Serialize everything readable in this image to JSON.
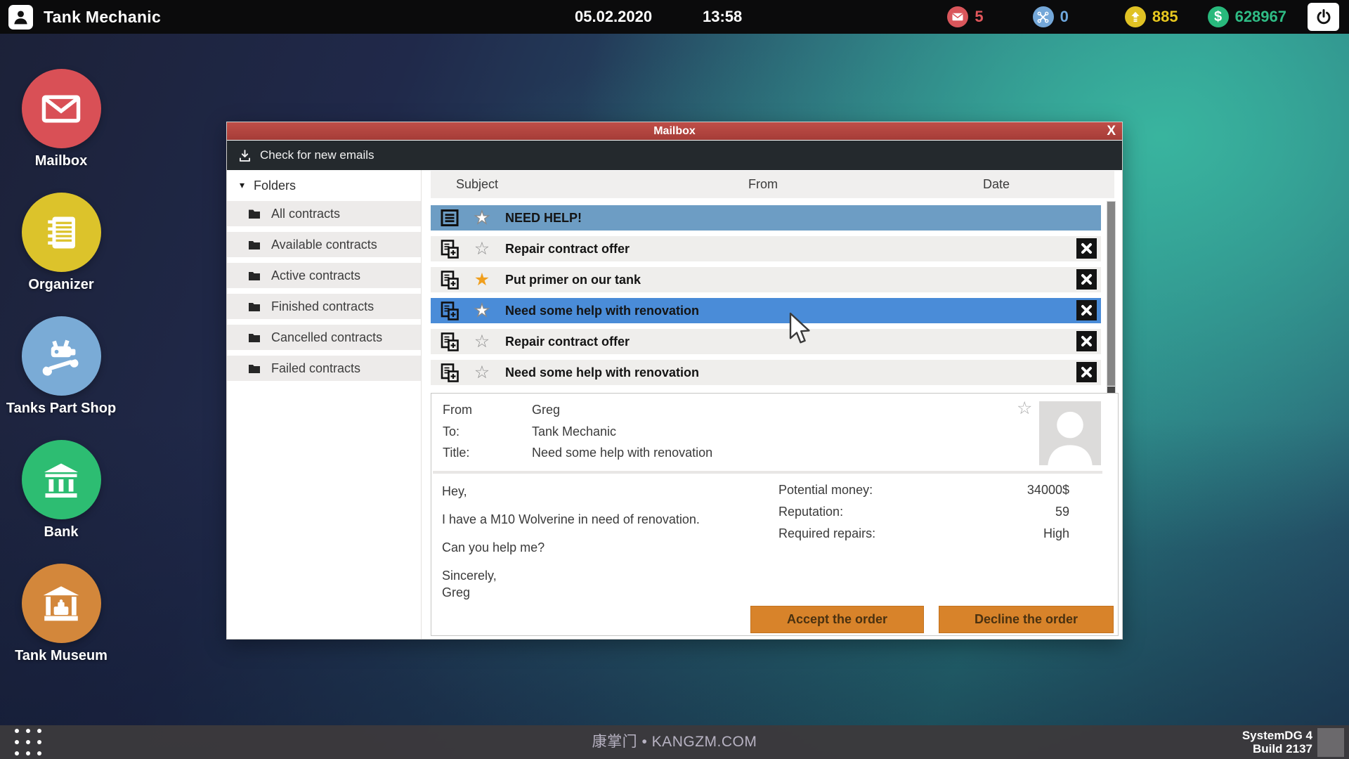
{
  "topbar": {
    "app_title": "Tank Mechanic",
    "date": "05.02.2020",
    "time": "13:58",
    "badges": {
      "messages": {
        "value": "5",
        "color": "#d9565b"
      },
      "repairs": {
        "value": "0",
        "color": "#74a7d8"
      },
      "xp": {
        "value": "885",
        "color": "#e0c224"
      },
      "money": {
        "value": "628967",
        "color": "#28b97c"
      }
    }
  },
  "desktop_icons": [
    {
      "label": "Mailbox",
      "color": "#d95056"
    },
    {
      "label": "Organizer",
      "color": "#dcc32b"
    },
    {
      "label": "Tanks Part Shop",
      "color": "#7aabd6"
    },
    {
      "label": "Bank",
      "color": "#2dbd72"
    },
    {
      "label": "Tank Museum",
      "color": "#d3873b"
    }
  ],
  "window": {
    "title": "Mailbox",
    "close_label": "X",
    "toolbar": {
      "check_label": "Check for new emails"
    },
    "folders": {
      "header": "Folders",
      "items": [
        "All contracts",
        "Available contracts",
        "Active contracts",
        "Finished contracts",
        "Cancelled contracts",
        "Failed contracts"
      ]
    },
    "list": {
      "columns": [
        "Subject",
        "From",
        "Date"
      ],
      "rows": [
        {
          "subject": "NEED HELP!",
          "icon": "message",
          "star": "white-filled",
          "selected": "steel-blue",
          "closable": false
        },
        {
          "subject": "Repair contract offer",
          "icon": "contract-offer",
          "star": "outline",
          "selected": null,
          "closable": true
        },
        {
          "subject": "Put primer on our tank",
          "icon": "contract-offer",
          "star": "orange-filled",
          "selected": null,
          "closable": true
        },
        {
          "subject": "Need some help with renovation",
          "icon": "contract-offer",
          "star": "white-filled",
          "selected": "bright-blue",
          "closable": true
        },
        {
          "subject": "Repair contract offer",
          "icon": "contract-offer",
          "star": "outline",
          "selected": null,
          "closable": true
        },
        {
          "subject": "Need some help with renovation",
          "icon": "contract-offer",
          "star": "outline",
          "selected": null,
          "closable": true
        }
      ]
    },
    "detail": {
      "from_label": "From",
      "from": "Greg",
      "to_label": "To:",
      "to": "Tank Mechanic",
      "title_label": "Title:",
      "title": "Need some help with renovation",
      "body": [
        "Hey,",
        "I have a M10 Wolverine in need of renovation.",
        "Can you help me?",
        "Sincerely,\nGreg"
      ],
      "stats": [
        {
          "label": "Potential money:",
          "value": "34000$"
        },
        {
          "label": "Reputation:",
          "value": "59"
        },
        {
          "label": "Required repairs:",
          "value": "High"
        }
      ],
      "accept_label": "Accept the order",
      "decline_label": "Decline the order"
    }
  },
  "taskbar": {
    "watermark": "康掌门 • KANGZM.COM",
    "system_name": "SystemDG 4",
    "build": "Build 2137"
  }
}
